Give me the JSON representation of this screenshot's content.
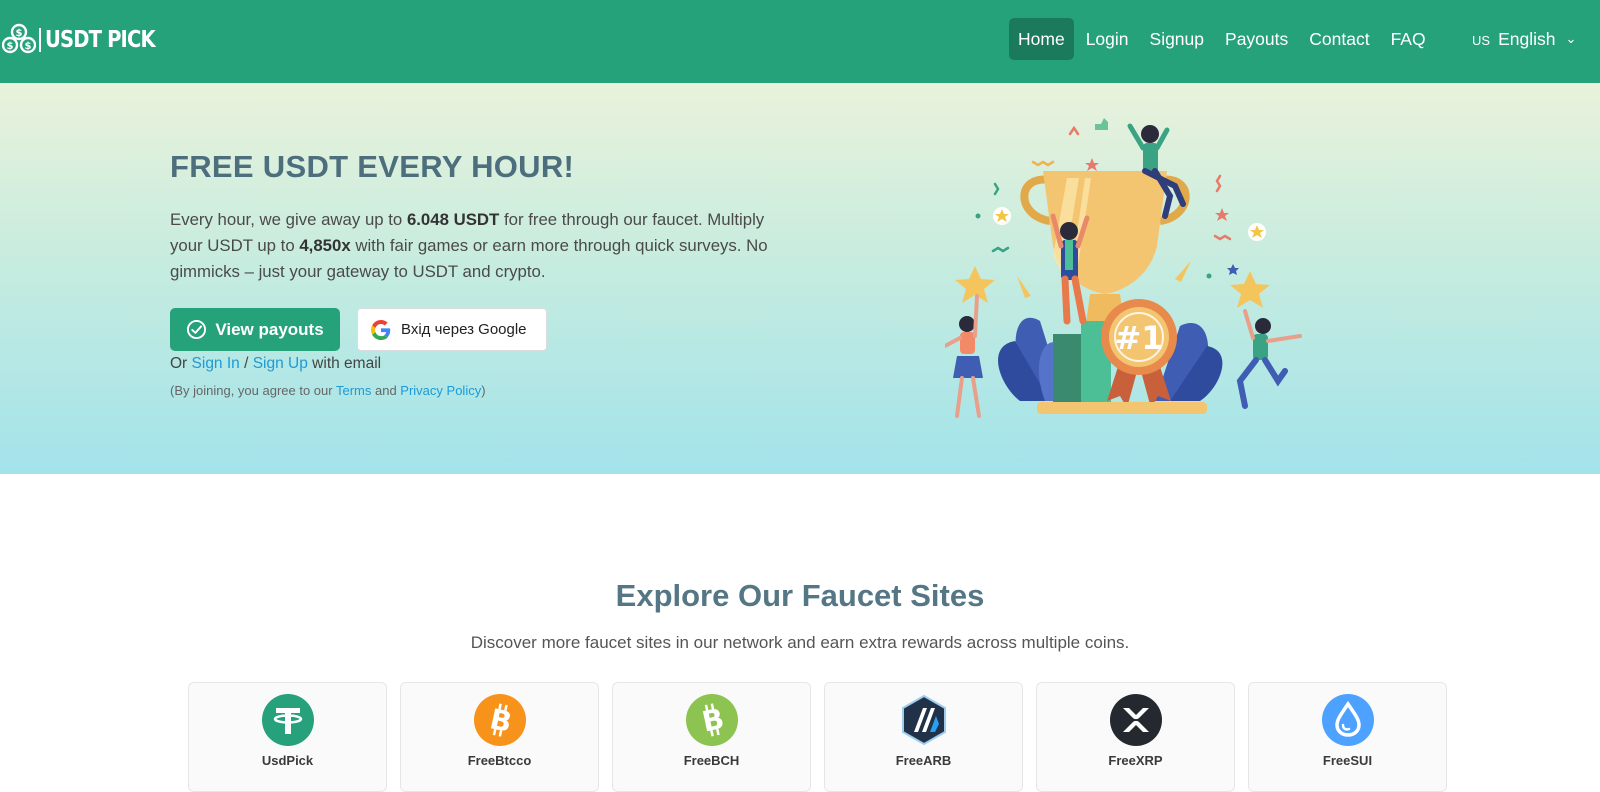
{
  "brand": {
    "name": "USDT PICK",
    "logo_icon": "coins-logo-icon"
  },
  "nav": {
    "items": [
      {
        "label": "Home",
        "active": true
      },
      {
        "label": "Login"
      },
      {
        "label": "Signup"
      },
      {
        "label": "Payouts"
      },
      {
        "label": "Contact"
      },
      {
        "label": "FAQ"
      }
    ],
    "language": {
      "code": "US",
      "label": "English"
    }
  },
  "hero": {
    "title": "FREE USDT EVERY HOUR!",
    "text_1": "Every hour, we give away up to ",
    "amount": "6.048 USDT",
    "text_2": " for free through our faucet. Multiply your USDT up to ",
    "multiplier": "4,850x",
    "text_3": " with fair games or earn more through quick surveys. No gimmicks – just your gateway to USDT and crypto.",
    "payouts_button": "View payouts",
    "google_button": "Вхід через Google",
    "or_text": "Or ",
    "sign_in_link": "Sign In",
    "slash": " / ",
    "sign_up_link": "Sign Up",
    "with_email": " with email",
    "terms_prefix": "(By joining, you agree to our ",
    "terms_link": "Terms",
    "and_text": " and ",
    "privacy_link": "Privacy Policy",
    "terms_suffix": ")",
    "illustration_icon": "trophy-celebration-illustration",
    "badge_text": "#1"
  },
  "explore": {
    "title": "Explore Our Faucet Sites",
    "subtitle": "Discover more faucet sites in our network and earn extra rewards across multiple coins.",
    "sites": [
      {
        "name": "UsdPick",
        "icon": "tether-icon",
        "color": "#26a17b"
      },
      {
        "name": "FreeBtcco",
        "icon": "bitcoin-icon",
        "color": "#f7931a"
      },
      {
        "name": "FreeBCH",
        "icon": "bitcoin-cash-icon",
        "color": "#8dc351"
      },
      {
        "name": "FreeARB",
        "icon": "arbitrum-icon",
        "color": "#213147"
      },
      {
        "name": "FreeXRP",
        "icon": "xrp-icon",
        "color": "#23292f"
      },
      {
        "name": "FreeSUI",
        "icon": "sui-icon",
        "color": "#4da2ff"
      }
    ]
  },
  "colors": {
    "primary": "#26a27a",
    "nav_active": "#1c7a5c",
    "link": "#1e9ad6"
  }
}
